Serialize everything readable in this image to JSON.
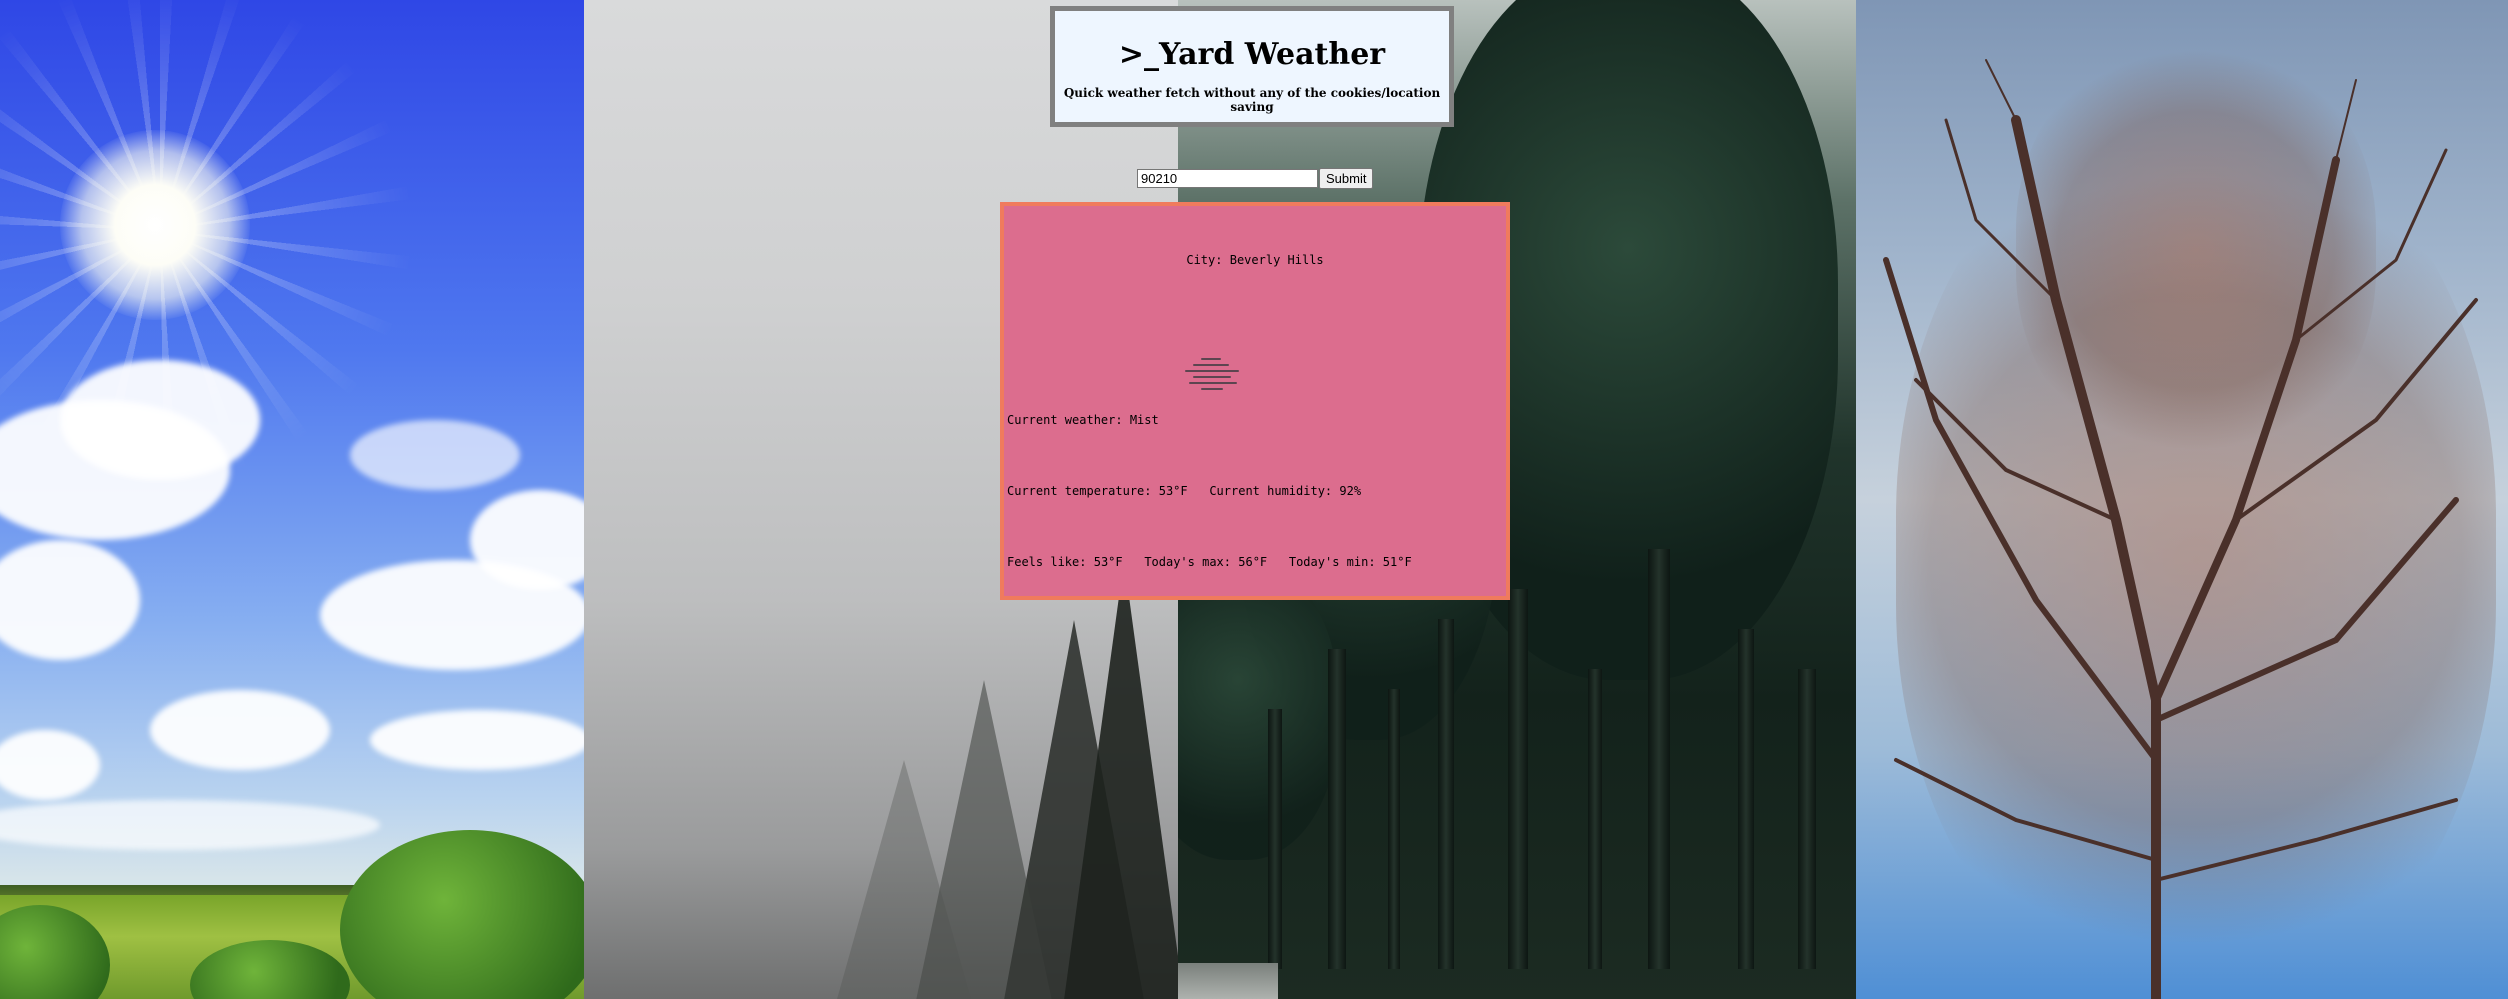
{
  "header": {
    "title": ">_Yard Weather",
    "subtitle": "Quick weather fetch without any of the cookies/location saving"
  },
  "search": {
    "zip_value": "90210",
    "submit_label": "Submit"
  },
  "weather": {
    "city_label": "City:",
    "city": "Beverly Hills",
    "icon": "mist-icon",
    "current_weather_label": "Current weather:",
    "current_weather": "Mist",
    "temperature_label": "Current temperature:",
    "temperature": "53°F",
    "humidity_label": "Current humidity:",
    "humidity": "92%",
    "feels_like_label": "Feels like:",
    "feels_like": "53°F",
    "max_label": "Today's max:",
    "max": "56°F",
    "min_label": "Today's min:",
    "min": "51°F"
  },
  "colors": {
    "header_bg": "#eef6ff",
    "header_border": "#808080",
    "card_bg": "#dc6d8e",
    "card_border": "#f07b5d"
  },
  "background_panels": [
    "sunny-sky",
    "fog",
    "forest",
    "winter-tree"
  ]
}
